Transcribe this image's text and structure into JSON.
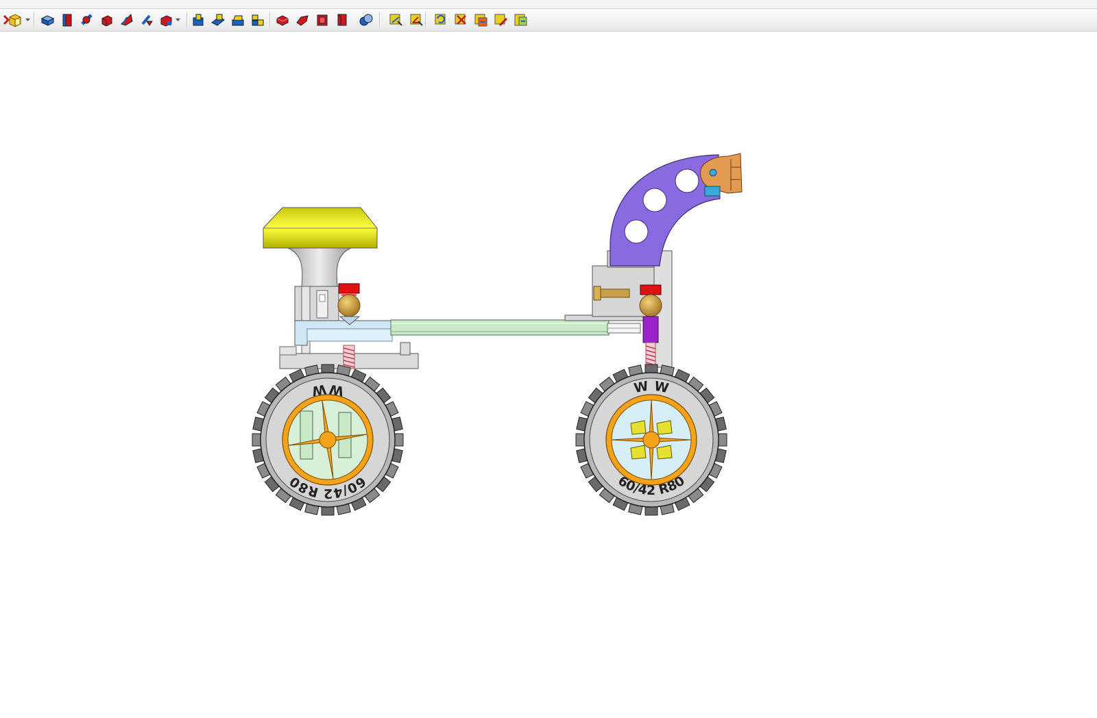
{
  "toolbar": {
    "buttons": [
      {
        "name": "part-cube-icon"
      },
      {
        "name": "part-box-icon"
      },
      {
        "name": "part-cylinder-icon"
      },
      {
        "name": "part-pipe-icon"
      },
      {
        "name": "part-wedge-icon"
      },
      {
        "name": "part-ramp-icon"
      },
      {
        "name": "part-pipe-bend-icon"
      },
      {
        "name": "part-block-red-icon"
      },
      {
        "name": "boolean-union-icon"
      },
      {
        "name": "boolean-cut-icon"
      },
      {
        "name": "extrude-icon"
      },
      {
        "name": "compound-icon"
      },
      {
        "name": "fillet-icon"
      },
      {
        "name": "chamfer-icon"
      },
      {
        "name": "shell-icon"
      },
      {
        "name": "offset-icon"
      },
      {
        "name": "boolean-icon"
      },
      {
        "name": "measure-linear-icon"
      },
      {
        "name": "measure-angular-icon"
      },
      {
        "name": "measure-refresh-icon"
      },
      {
        "name": "measure-clear-icon"
      },
      {
        "name": "measure-toggle-all-icon"
      },
      {
        "name": "measure-toggle-3d-icon"
      },
      {
        "name": "measure-toggle-delta-icon"
      }
    ]
  },
  "colors": {
    "tire": "#d6d6d6",
    "rim": "#f5a31a",
    "knob": "#e6e61a",
    "arm": "#8a6ae0",
    "clamp": "#e39b52",
    "axle": "#c8e8c8",
    "frame": "#cfe6f4",
    "spring": "#f0a0b0",
    "red_cap": "#dd1111",
    "ball": "#c89a3a",
    "purple": "#9b22cc"
  },
  "wheels": {
    "left": {
      "label_top": "60/42 R80",
      "label_bottom": "W W"
    },
    "right": {
      "label_top": "W W",
      "label_bottom": "60/42 R80"
    }
  }
}
